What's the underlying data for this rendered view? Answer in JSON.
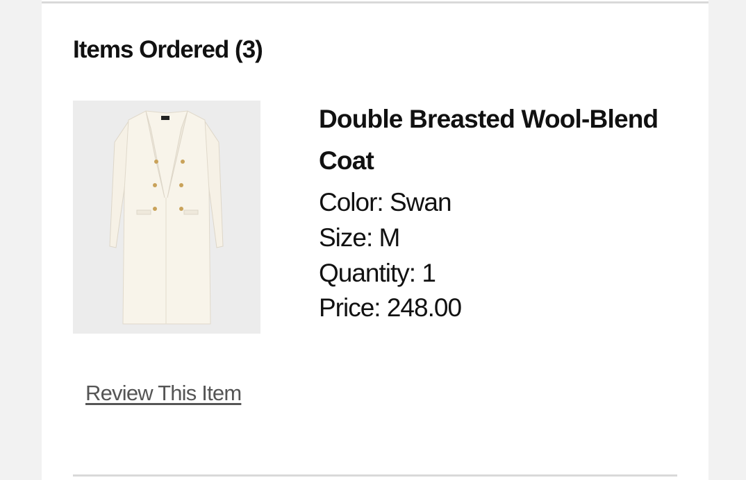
{
  "order": {
    "section_title": "Items Ordered (3)",
    "item": {
      "image_icon": "coat-product-photo",
      "name": "Double Breasted Wool-Blend Coat",
      "color_line": "Color: Swan",
      "size_line": "Size: M",
      "quantity_line": "Quantity: 1",
      "price_line": "Price: 248.00"
    },
    "review_link": "Review This Item"
  }
}
